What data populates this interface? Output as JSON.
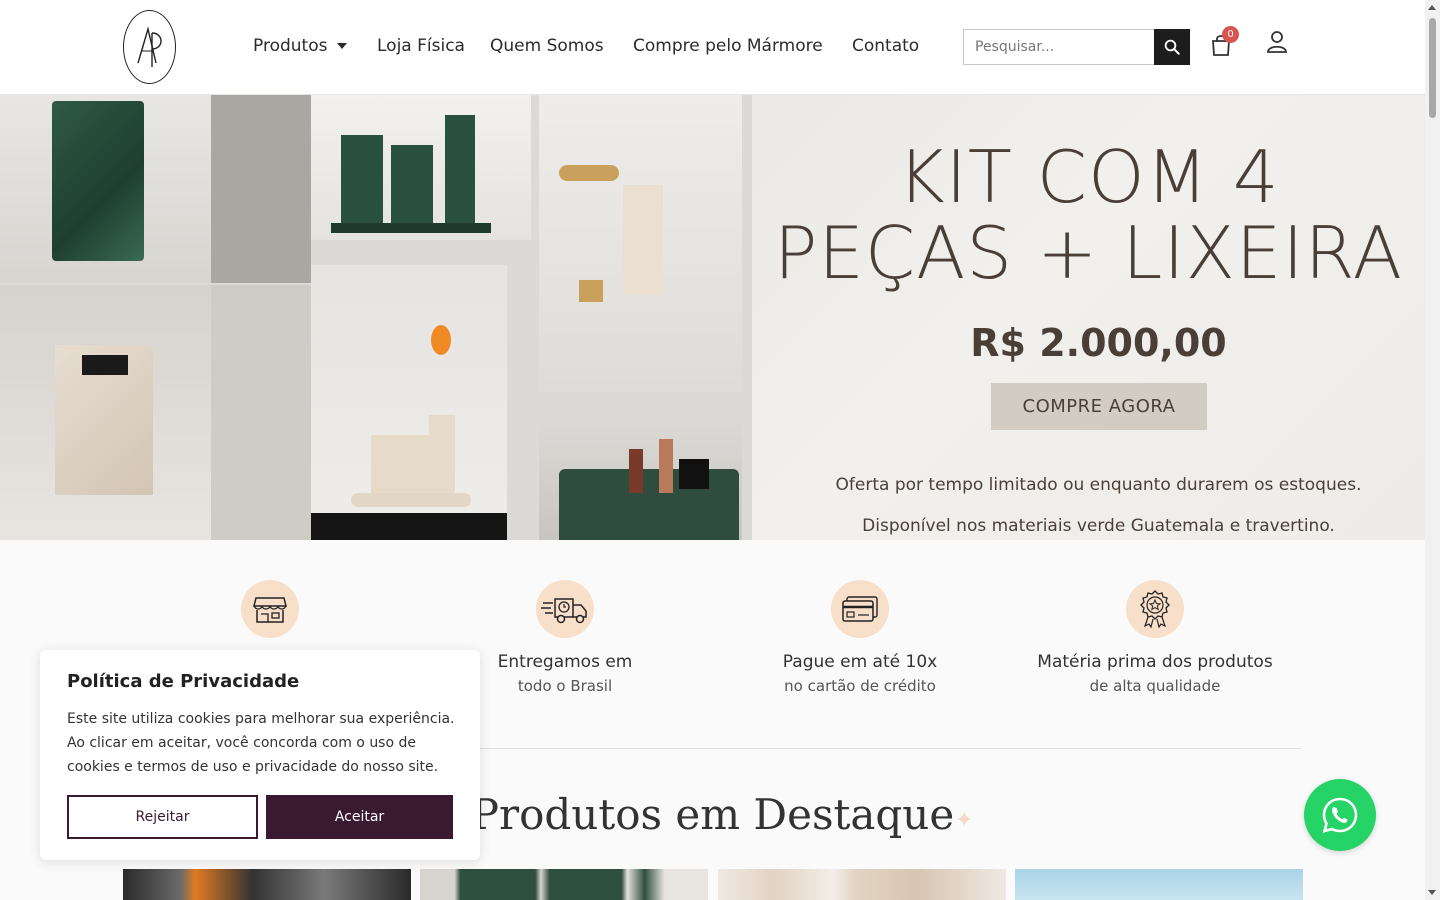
{
  "header": {
    "logo_alt": "AP",
    "nav": [
      {
        "label": "Produtos"
      },
      {
        "label": "Loja Física"
      },
      {
        "label": "Quem Somos"
      },
      {
        "label": "Compre pelo Mármore"
      },
      {
        "label": "Contato"
      }
    ],
    "search": {
      "placeholder": "Pesquisar..."
    },
    "cart": {
      "count": "0"
    }
  },
  "hero": {
    "title_line1": "KIT COM 4",
    "title_line2": "PEÇAS + LIXEIRA",
    "price": "R$ 2.000,00",
    "cta": "COMPRE AGORA",
    "note1": "Oferta por tempo limitado ou enquanto durarem os estoques.",
    "note2": "Disponível nos materiais verde Guatemala e travertino."
  },
  "features": [
    {
      "title": "",
      "subtitle": "",
      "icon": "store-icon"
    },
    {
      "title": "Entregamos em",
      "subtitle": "todo o Brasil",
      "icon": "delivery-truck-icon"
    },
    {
      "title": "Pague em até 10x",
      "subtitle": "no cartão de crédito",
      "icon": "credit-card-icon"
    },
    {
      "title": "Matéria prima dos produtos",
      "subtitle": "de alta qualidade",
      "icon": "quality-badge-icon"
    }
  ],
  "section": {
    "title": "Produtos em Destaque"
  },
  "cookie": {
    "title": "Política de Privacidade",
    "text": "Este site utiliza cookies para melhorar sua experiência. Ao clicar em aceitar, você concorda com o uso de cookies e termos de uso e privacidade do nosso site.",
    "reject": "Rejeitar",
    "accept": "Aceitar"
  },
  "colors": {
    "accent": "#3a1a31",
    "icon_bg": "#f8dfc9",
    "whatsapp": "#25d366",
    "hero_text": "#4a3f36"
  }
}
